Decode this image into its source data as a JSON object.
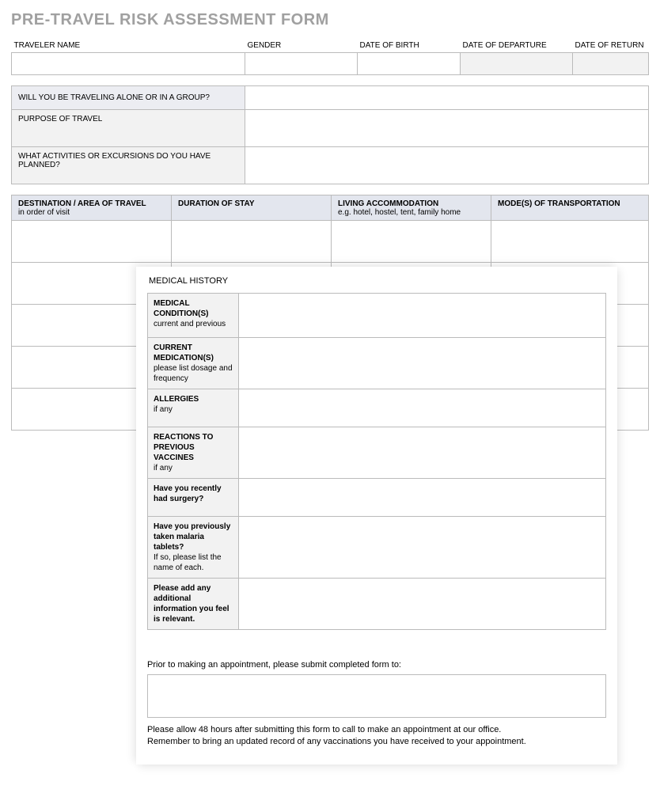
{
  "title": "PRE-TRAVEL RISK ASSESSMENT FORM",
  "section1": {
    "traveler_name": "TRAVELER NAME",
    "gender": "GENDER",
    "date_of_birth": "DATE OF BIRTH",
    "date_of_departure": "DATE OF DEPARTURE",
    "date_of_return": "DATE OF RETURN"
  },
  "section2": {
    "q_alone": "WILL YOU BE TRAVELING ALONE OR IN A GROUP?",
    "purpose": "PURPOSE OF TRAVEL",
    "activities": "WHAT ACTIVITIES OR EXCURSIONS DO YOU HAVE PLANNED?"
  },
  "section3": {
    "destination": "DESTINATION / AREA OF TRAVEL",
    "destination_sub": "in order of visit",
    "duration": "DURATION OF STAY",
    "accommodation": "LIVING ACCOMMODATION",
    "accommodation_sub": "e.g. hotel, hostel, tent, family home",
    "transportation": "MODE(S) OF TRANSPORTATION"
  },
  "overlay": {
    "heading": "MEDICAL HISTORY",
    "rows": {
      "r1_label": "MEDICAL CONDITION(S)",
      "r1_sub": "current and previous",
      "r2_label": "CURRENT MEDICATION(S)",
      "r2_sub": "please list dosage and frequency",
      "r3_label": "ALLERGIES",
      "r3_sub": "if any",
      "r4_label": "REACTIONS TO PREVIOUS VACCINES",
      "r4_sub": "if any",
      "r5_label": "Have you recently had surgery?",
      "r6_label": "Have you previously taken malaria tablets?",
      "r6_sub": "If so, please list the name of each.",
      "r7_label": "Please add any additional information you feel is relevant."
    },
    "note1": "Prior to making an appointment, please submit completed form to:",
    "note2a": "Please allow 48 hours after submitting this form to call to make an appointment at our office.",
    "note2b": "Remember to bring an updated record of any vaccinations you have received to your appointment."
  }
}
